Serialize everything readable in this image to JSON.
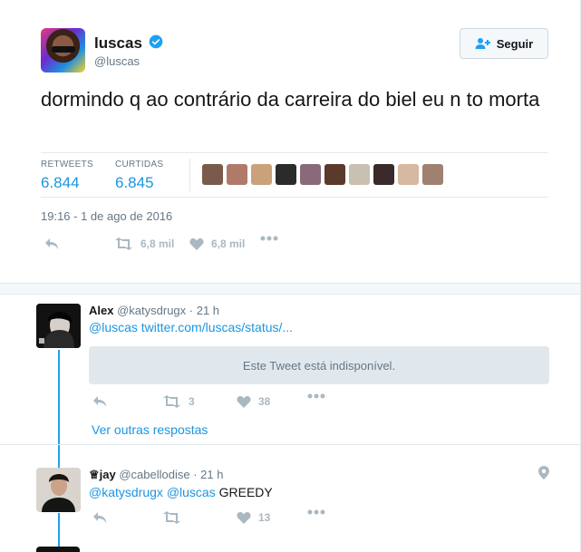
{
  "tweet": {
    "author_name": "luscas",
    "author_handle": "@luscas",
    "follow_label": "Seguir",
    "text": "dormindo q ao contrário da carreira do biel eu n to morta",
    "retweets_label": "RETWEETS",
    "retweets_value": "6.844",
    "likes_label": "CURTIDAS",
    "likes_value": "6.845",
    "timestamp": "19:16 - 1 de ago de 2016",
    "action_retweet_count": "6,8 mil",
    "action_like_count": "6,8 mil",
    "liker_colors": [
      "#7a5a4a",
      "#b07a6a",
      "#c9a27a",
      "#2b2b2b",
      "#8a6a7a",
      "#5a3a2a",
      "#c8c0b0",
      "#3a2a2a",
      "#d7b8a0",
      "#a08070"
    ]
  },
  "replies": [
    {
      "name": "Alex",
      "handle": "@katysdrugx",
      "time": "· 21 h",
      "mention": "@luscas",
      "link": "twitter.com/luscas/status/...",
      "unavailable": "Este Tweet está indisponível.",
      "retweet_count": "3",
      "like_count": "38"
    },
    {
      "name": "♕jay",
      "handle": "@cabellodise",
      "time": "· 21 h",
      "mention1": "@katysdrugx",
      "mention2": "@luscas",
      "text": "GREEDY",
      "retweet_count": "",
      "like_count": "13"
    }
  ],
  "more_replies_label": "Ver outras respostas",
  "colors": {
    "accent": "#1b95e0",
    "muted": "#aab8c2"
  }
}
